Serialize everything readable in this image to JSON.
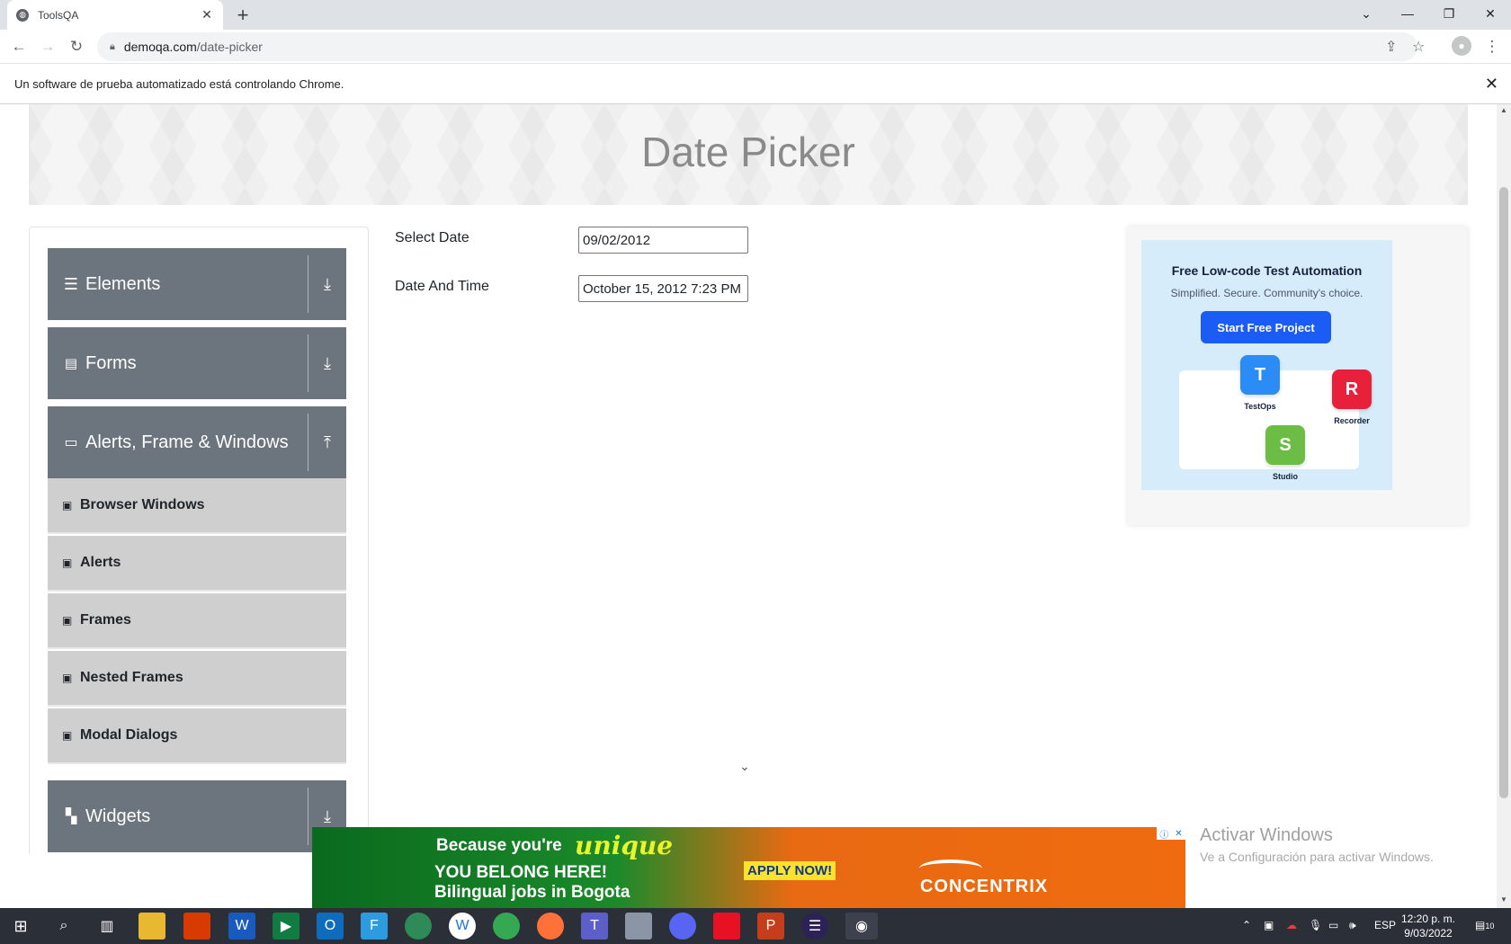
{
  "browser": {
    "tab_title": "ToolsQA",
    "url_host": "demoqa.com",
    "url_path": "/date-picker",
    "infobar_text": "Un software de prueba automatizado está controlando Chrome."
  },
  "page": {
    "title": "Date Picker"
  },
  "sidebar": {
    "groups": [
      {
        "label": "Elements",
        "icon": "hamburger-icon",
        "expanded": false
      },
      {
        "label": "Forms",
        "icon": "document-icon",
        "expanded": false
      },
      {
        "label": "Alerts, Frame & Windows",
        "icon": "window-icon",
        "expanded": true
      },
      {
        "label": "Widgets",
        "icon": "widgets-icon",
        "expanded": false
      }
    ],
    "items": [
      {
        "label": "Browser Windows"
      },
      {
        "label": "Alerts"
      },
      {
        "label": "Frames"
      },
      {
        "label": "Nested Frames"
      },
      {
        "label": "Modal Dialogs"
      }
    ]
  },
  "form": {
    "select_date_label": "Select Date",
    "select_date_value": "09/02/2012",
    "date_time_label": "Date And Time",
    "date_time_value": "October 15, 2012 7:23 PM"
  },
  "side_ad": {
    "title": "Free Low-code Test Automation",
    "subtitle": "Simplified. Secure. Community's choice.",
    "button": "Start Free Project",
    "apps": [
      {
        "label": "TestOps",
        "letter": "T",
        "color": "#2b8cf5"
      },
      {
        "label": "Recorder",
        "letter": "R",
        "color": "#e8203a"
      },
      {
        "label": "Studio",
        "letter": "S",
        "color": "#6cbd45"
      }
    ]
  },
  "bottom_ad": {
    "line1": "Because you're",
    "unique": "unique",
    "line2": "YOU BELONG HERE!",
    "line3": "Bilingual jobs in Bogota",
    "apply": "APPLY NOW!",
    "brand": "CONCENTRIX"
  },
  "watermark": {
    "title": "Activar Windows",
    "subtitle": "Ve a Configuración para activar Windows."
  },
  "taskbar": {
    "language": "ESP",
    "time": "12:20 p. m.",
    "date": "9/03/2022",
    "notifications": "10"
  }
}
